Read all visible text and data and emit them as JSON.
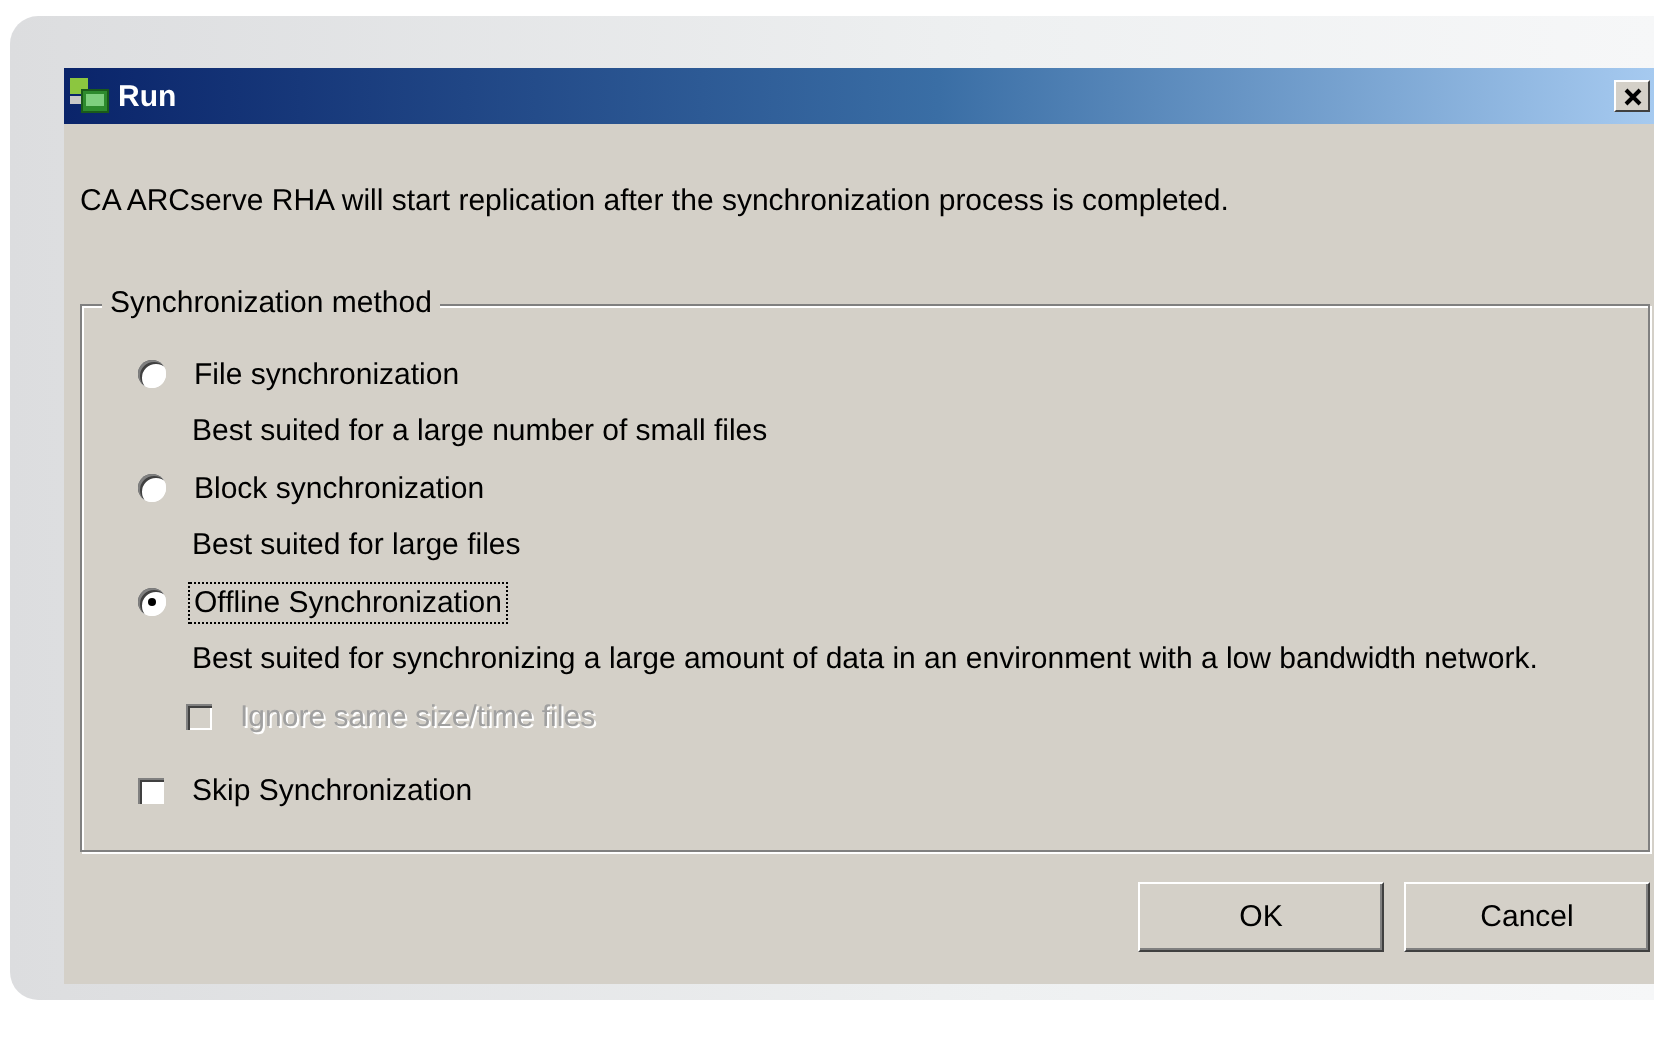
{
  "window": {
    "title": "Run"
  },
  "message": "CA ARCserve RHA will start replication after the synchronization process is completed.",
  "group": {
    "title": "Synchronization method",
    "options": [
      {
        "kind": "radio",
        "label": "File synchronization",
        "selected": false,
        "description": "Best suited for a large number of small files"
      },
      {
        "kind": "radio",
        "label": "Block synchronization",
        "selected": false,
        "description": "Best suited for large files"
      },
      {
        "kind": "radio",
        "label": "Offline Synchronization",
        "selected": true,
        "description": "Best suited for synchronizing a large amount of data in an environment with a low bandwidth network.",
        "sub_option": {
          "label": "Ignore same size/time files",
          "checked": false,
          "disabled": true
        }
      },
      {
        "kind": "checkbox",
        "label": "Skip Synchronization",
        "checked": false,
        "disabled": false
      }
    ]
  },
  "buttons": [
    {
      "label": "OK"
    },
    {
      "label": "Cancel"
    }
  ]
}
